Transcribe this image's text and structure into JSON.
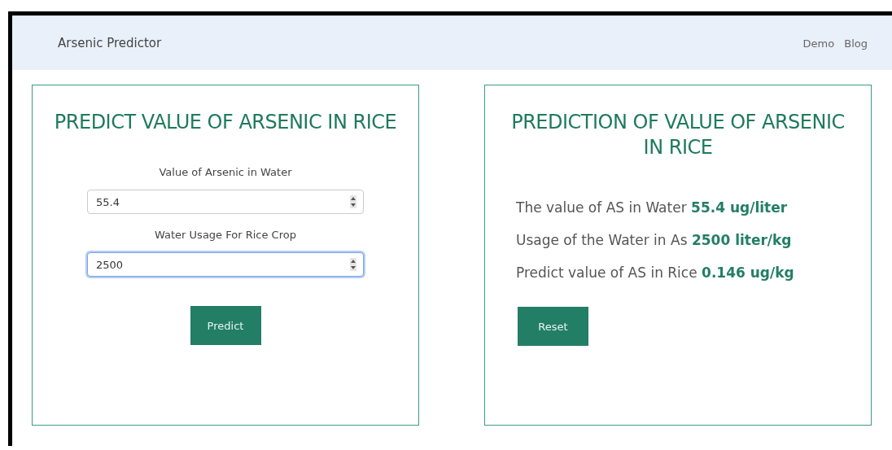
{
  "navbar": {
    "brand": "Arsenic Predictor",
    "links": [
      "Demo",
      "Blog"
    ]
  },
  "form": {
    "title": "PREDICT VALUE OF ARSENIC IN RICE",
    "fields": [
      {
        "label": "Value of Arsenic in Water",
        "value": "55.4",
        "focused": false
      },
      {
        "label": "Water Usage For Rice Crop",
        "value": "2500",
        "focused": true
      }
    ],
    "button": "Predict"
  },
  "result": {
    "title": "PREDICTION OF VALUE OF ARSENIC IN RICE",
    "lines": [
      "The value of AS in Water **55.4 ug/liter**",
      "Usage of the Water in As **2500 liter/kg**",
      "Predict value of AS in Rice **0.146 ug/kg**"
    ],
    "button": "Reset"
  }
}
